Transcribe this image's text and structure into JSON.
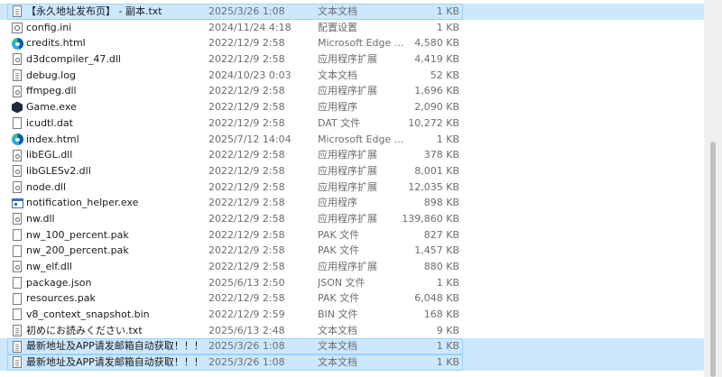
{
  "files": [
    {
      "name": "【永久地址发布页】 - 副本.txt",
      "date": "2025/3/26 1:08",
      "type": "文本文档",
      "size": "1 KB",
      "icon": "text-file-icon",
      "selected": true
    },
    {
      "name": "config.ini",
      "date": "2024/11/24 4:18",
      "type": "配置设置",
      "size": "1 KB",
      "icon": "config-file-icon",
      "selected": false
    },
    {
      "name": "credits.html",
      "date": "2022/12/9 2:58",
      "type": "Microsoft Edge ...",
      "size": "4,580 KB",
      "icon": "edge-icon",
      "selected": false
    },
    {
      "name": "d3dcompiler_47.dll",
      "date": "2022/12/9 2:58",
      "type": "应用程序扩展",
      "size": "4,419 KB",
      "icon": "dll-file-icon",
      "selected": false
    },
    {
      "name": "debug.log",
      "date": "2024/10/23 0:03",
      "type": "文本文档",
      "size": "52 KB",
      "icon": "text-file-icon",
      "selected": false
    },
    {
      "name": "ffmpeg.dll",
      "date": "2022/12/9 2:58",
      "type": "应用程序扩展",
      "size": "1,696 KB",
      "icon": "dll-file-icon",
      "selected": false
    },
    {
      "name": "Game.exe",
      "date": "2022/12/9 2:58",
      "type": "应用程序",
      "size": "2,090 KB",
      "icon": "game-exe-icon",
      "selected": false
    },
    {
      "name": "icudtl.dat",
      "date": "2022/12/9 2:58",
      "type": "DAT 文件",
      "size": "10,272 KB",
      "icon": "blank-file-icon",
      "selected": false
    },
    {
      "name": "index.html",
      "date": "2025/7/12 14:04",
      "type": "Microsoft Edge ...",
      "size": "1 KB",
      "icon": "edge-icon",
      "selected": false
    },
    {
      "name": "libEGL.dll",
      "date": "2022/12/9 2:58",
      "type": "应用程序扩展",
      "size": "378 KB",
      "icon": "dll-file-icon",
      "selected": false
    },
    {
      "name": "libGLESv2.dll",
      "date": "2022/12/9 2:58",
      "type": "应用程序扩展",
      "size": "8,001 KB",
      "icon": "dll-file-icon",
      "selected": false
    },
    {
      "name": "node.dll",
      "date": "2022/12/9 2:58",
      "type": "应用程序扩展",
      "size": "12,035 KB",
      "icon": "dll-file-icon",
      "selected": false
    },
    {
      "name": "notification_helper.exe",
      "date": "2022/12/9 2:58",
      "type": "应用程序",
      "size": "898 KB",
      "icon": "app-exe-icon",
      "selected": false
    },
    {
      "name": "nw.dll",
      "date": "2022/12/9 2:58",
      "type": "应用程序扩展",
      "size": "139,860 KB",
      "icon": "dll-file-icon",
      "selected": false
    },
    {
      "name": "nw_100_percent.pak",
      "date": "2022/12/9 2:58",
      "type": "PAK 文件",
      "size": "827 KB",
      "icon": "blank-file-icon",
      "selected": false
    },
    {
      "name": "nw_200_percent.pak",
      "date": "2022/12/9 2:58",
      "type": "PAK 文件",
      "size": "1,457 KB",
      "icon": "blank-file-icon",
      "selected": false
    },
    {
      "name": "nw_elf.dll",
      "date": "2022/12/9 2:58",
      "type": "应用程序扩展",
      "size": "880 KB",
      "icon": "dll-file-icon",
      "selected": false
    },
    {
      "name": "package.json",
      "date": "2025/6/13 2:50",
      "type": "JSON 文件",
      "size": "1 KB",
      "icon": "blank-file-icon",
      "selected": false
    },
    {
      "name": "resources.pak",
      "date": "2022/12/9 2:58",
      "type": "PAK 文件",
      "size": "6,048 KB",
      "icon": "blank-file-icon",
      "selected": false
    },
    {
      "name": "v8_context_snapshot.bin",
      "date": "2022/12/9 2:59",
      "type": "BIN 文件",
      "size": "168 KB",
      "icon": "blank-file-icon",
      "selected": false
    },
    {
      "name": "初めにお読みください.txt",
      "date": "2025/6/13 2:48",
      "type": "文本文档",
      "size": "9 KB",
      "icon": "text-file-icon",
      "selected": false
    },
    {
      "name": "最新地址及APP请发邮箱自动获取！！！...",
      "date": "2025/3/26 1:08",
      "type": "文本文档",
      "size": "1 KB",
      "icon": "text-file-icon",
      "selected": true
    },
    {
      "name": "最新地址及APP请发邮箱自动获取！！！...",
      "date": "2025/3/26 1:08",
      "type": "文本文档",
      "size": "1 KB",
      "icon": "text-file-icon",
      "selected": true
    }
  ],
  "colors": {
    "selection": "#cce8ff",
    "selection_border": "#99d1ff",
    "secondary_text": "#6d6d6d"
  }
}
